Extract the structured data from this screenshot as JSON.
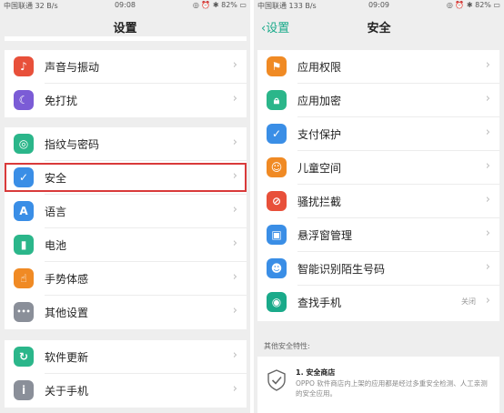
{
  "left_screen": {
    "status": {
      "carrier": "中国联通",
      "speed": "32 B/s",
      "time": "09:08",
      "battery": "82%"
    },
    "title": "设置",
    "group1": [
      {
        "label": "声音与振动",
        "icon": "volume-icon",
        "color": "#e8503a"
      },
      {
        "label": "免打扰",
        "icon": "moon-icon",
        "color": "#7b5cd6"
      }
    ],
    "group2": [
      {
        "label": "指纹与密码",
        "icon": "fingerprint-icon",
        "color": "#2bb68a"
      },
      {
        "label": "安全",
        "icon": "shield-icon",
        "color": "#3a8ee6"
      },
      {
        "label": "语言",
        "icon": "language-icon",
        "color": "#3a8ee6"
      },
      {
        "label": "电池",
        "icon": "battery-icon",
        "color": "#2bb68a"
      },
      {
        "label": "手势体感",
        "icon": "hand-icon",
        "color": "#f08a24"
      },
      {
        "label": "其他设置",
        "icon": "more-icon",
        "color": "#8a8f99"
      }
    ],
    "group3": [
      {
        "label": "软件更新",
        "icon": "update-icon",
        "color": "#2bb68a"
      },
      {
        "label": "关于手机",
        "icon": "info-icon",
        "color": "#8a8f99"
      }
    ]
  },
  "right_screen": {
    "status": {
      "carrier": "中国联通",
      "speed": "133 B/s",
      "time": "09:09",
      "battery": "82%"
    },
    "back_label": "设置",
    "title": "安全",
    "items": [
      {
        "label": "应用权限",
        "icon": "app-permission-icon",
        "color": "#f08a24",
        "value": ""
      },
      {
        "label": "应用加密",
        "icon": "lock-icon",
        "color": "#2bb68a",
        "value": ""
      },
      {
        "label": "支付保护",
        "icon": "payment-shield-icon",
        "color": "#3a8ee6",
        "value": ""
      },
      {
        "label": "儿童空间",
        "icon": "child-icon",
        "color": "#f08a24",
        "value": ""
      },
      {
        "label": "骚扰拦截",
        "icon": "block-icon",
        "color": "#e8503a",
        "value": ""
      },
      {
        "label": "悬浮窗管理",
        "icon": "floating-window-icon",
        "color": "#3a8ee6",
        "value": ""
      },
      {
        "label": "智能识别陌生号码",
        "icon": "contact-icon",
        "color": "#3a8ee6",
        "value": ""
      },
      {
        "label": "查找手机",
        "icon": "find-phone-icon",
        "color": "#1aaa8a",
        "value": "关闭"
      }
    ],
    "other_title": "其他安全特性:",
    "feature": {
      "title": "1. 安全商店",
      "desc": "OPPO 软件商店内上架的应用都是经过多重安全检测、人工亲测的安全应用。"
    }
  }
}
